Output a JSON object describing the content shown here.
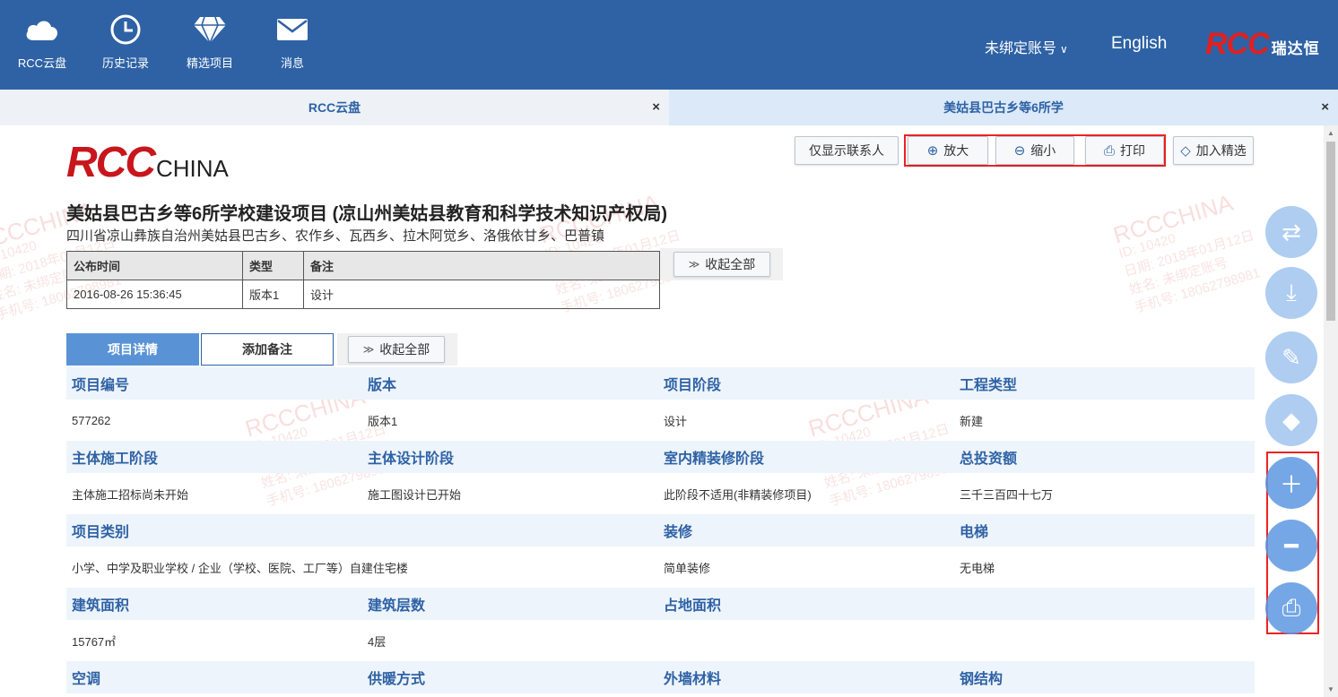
{
  "topnav": {
    "items": [
      {
        "label": "RCC云盘",
        "icon": "cloud-icon"
      },
      {
        "label": "历史记录",
        "icon": "clock-icon"
      },
      {
        "label": "精选项目",
        "icon": "diamond-icon"
      },
      {
        "label": "消息",
        "icon": "mail-icon"
      }
    ],
    "account": "未绑定账号",
    "language": "English",
    "logo_rcc": "RCC",
    "logo_cn": "瑞达恒"
  },
  "tabs": [
    {
      "label": "RCC云盘",
      "close": "×"
    },
    {
      "label": "美姑县巴古乡等6所学",
      "close": "×"
    }
  ],
  "brand": {
    "rcc": "RCC",
    "china": "CHINA"
  },
  "toolbar": {
    "contacts_only": "仅显示联系人",
    "zoom_in": "放大",
    "zoom_out": "缩小",
    "print": "打印",
    "add_featured": "加入精选",
    "collapse_all": "收起全部"
  },
  "project": {
    "title": "美姑县巴古乡等6所学校建设项目 (凉山州美姑县教育和科学技术知识产权局)",
    "address": "四川省凉山彝族自治州美姑县巴古乡、农作乡、瓦西乡、拉木阿觉乡、洛俄依甘乡、巴普镇"
  },
  "publish_table": {
    "headers": [
      "公布时间",
      "类型",
      "备注"
    ],
    "row": [
      "2016-08-26 15:36:45",
      "版本1",
      "设计"
    ]
  },
  "section_tabs": {
    "details": "项目详情",
    "add_note": "添加备注",
    "collapse_all": "收起全部"
  },
  "detail_grid": [
    {
      "labels": [
        "项目编号",
        "版本",
        "项目阶段",
        "工程类型"
      ],
      "values": [
        "577262",
        "版本1",
        "设计",
        "新建"
      ]
    },
    {
      "labels": [
        "主体施工阶段",
        "主体设计阶段",
        "室内精装修阶段",
        "总投资额"
      ],
      "values": [
        "主体施工招标尚未开始",
        "施工图设计已开始",
        "此阶段不适用(非精装修项目)",
        "三千三百四十七万"
      ]
    },
    {
      "labels": [
        "项目类别",
        "",
        "装修",
        "电梯"
      ],
      "values": [
        "小学、中学及职业学校 / 企业（学校、医院、工厂等）自建住宅楼",
        "",
        "简单装修",
        "无电梯"
      ]
    },
    {
      "labels": [
        "建筑面积",
        "建筑层数",
        "占地面积",
        ""
      ],
      "values": [
        "15767㎡",
        "4层",
        "",
        ""
      ]
    },
    {
      "labels": [
        "空调",
        "供暖方式",
        "外墙材料",
        "钢结构"
      ],
      "values": [
        "",
        "",
        "",
        ""
      ]
    }
  ],
  "watermark": {
    "logo": "RCC",
    "logo_suffix": "CHINA",
    "id": "ID: 10420",
    "date": "日期: 2018年01月12日",
    "name": "姓名: 未绑定账号",
    "phone": "手机号: 18062798981"
  },
  "floating_buttons": [
    "share-icon",
    "download-icon",
    "edit-icon",
    "diamond-icon",
    "plus-icon",
    "minus-icon",
    "print-icon"
  ],
  "colors": {
    "header": "#2e62a5",
    "accent_red": "#e22222",
    "label_blue": "#2e62a5",
    "row_bg": "#eef4fb"
  }
}
